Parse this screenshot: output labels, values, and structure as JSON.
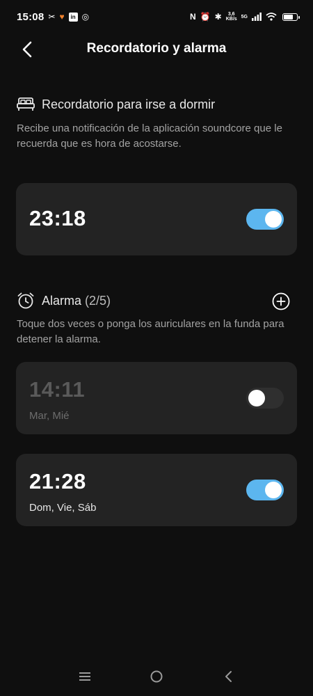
{
  "status_bar": {
    "time": "15:08",
    "net_speed_top": "3,6",
    "net_speed_bottom": "KB/s",
    "network_type": "5G"
  },
  "header": {
    "title": "Recordatorio y alarma"
  },
  "bedtime": {
    "title": "Recordatorio para irse a dormir",
    "description": "Recibe una notificación de la aplicación soundcore que le recuerda que es hora de acostarse.",
    "time": "23:18",
    "enabled": true
  },
  "alarms": {
    "title": "Alarma",
    "count": "(2/5)",
    "description": "Toque dos veces o ponga los auriculares en la funda para detener la alarma.",
    "items": [
      {
        "time": "14:11",
        "days": "Mar, Mié",
        "enabled": false
      },
      {
        "time": "21:28",
        "days": "Dom, Vie, Sáb",
        "enabled": true
      }
    ]
  },
  "colors": {
    "background": "#0f0f0f",
    "card": "#232323",
    "toggle_on": "#5cb6ef",
    "toggle_off": "#2f2f2f"
  }
}
